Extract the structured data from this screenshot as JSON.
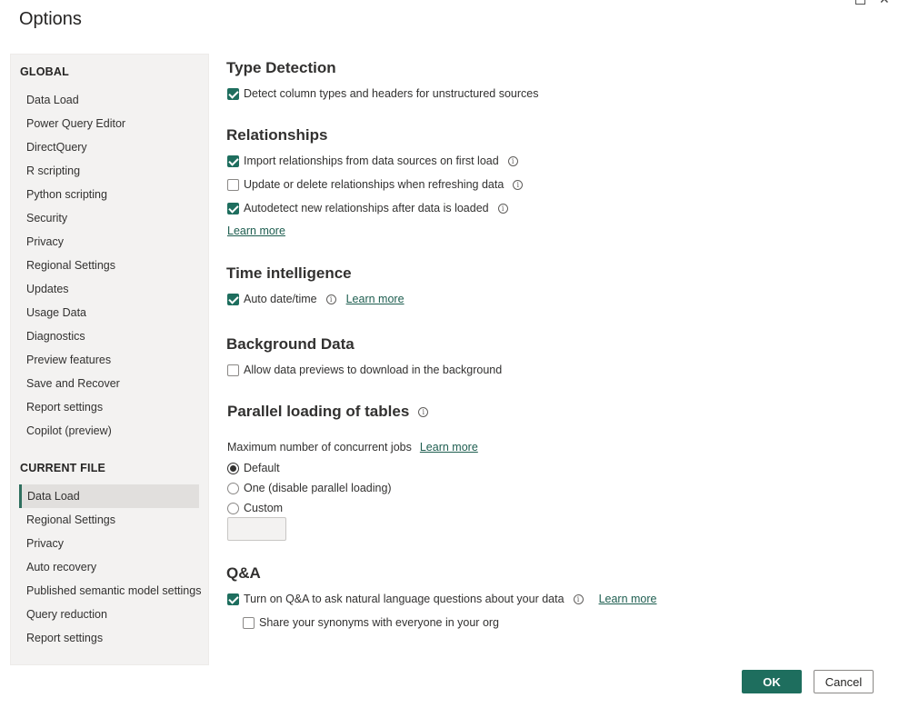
{
  "dialog": {
    "title": "Options"
  },
  "sidebar": {
    "global_header": "GLOBAL",
    "global_items": [
      "Data Load",
      "Power Query Editor",
      "DirectQuery",
      "R scripting",
      "Python scripting",
      "Security",
      "Privacy",
      "Regional Settings",
      "Updates",
      "Usage Data",
      "Diagnostics",
      "Preview features",
      "Save and Recover",
      "Report settings",
      "Copilot (preview)"
    ],
    "current_header": "CURRENT FILE",
    "current_items": [
      "Data Load",
      "Regional Settings",
      "Privacy",
      "Auto recovery",
      "Published semantic model settings",
      "Query reduction",
      "Report settings"
    ],
    "active_item": "Data Load"
  },
  "sections": {
    "type_detection": {
      "title": "Type Detection",
      "detect_label": "Detect column types and headers for unstructured sources",
      "detect_checked": true
    },
    "relationships": {
      "title": "Relationships",
      "import_label": "Import relationships from data sources on first load",
      "import_checked": true,
      "update_label": "Update or delete relationships when refreshing data",
      "update_checked": false,
      "autodetect_label": "Autodetect new relationships after data is loaded",
      "autodetect_checked": true,
      "learn_more": "Learn more"
    },
    "time_intelligence": {
      "title": "Time intelligence",
      "auto_label": "Auto date/time",
      "auto_checked": true,
      "learn_more": "Learn more"
    },
    "background_data": {
      "title": "Background Data",
      "allow_label": "Allow data previews to download in the background",
      "allow_checked": false
    },
    "parallel_loading": {
      "title": "Parallel loading of tables",
      "max_jobs_label": "Maximum number of concurrent jobs",
      "learn_more": "Learn more",
      "options": [
        "Default",
        "One (disable parallel loading)",
        "Custom"
      ],
      "selected": "Default",
      "custom_value": ""
    },
    "qna": {
      "title": "Q&A",
      "turn_on_label": "Turn on Q&A to ask natural language questions about your data",
      "turn_on_checked": true,
      "learn_more": "Learn more",
      "share_label": "Share your synonyms with everyone in your org",
      "share_checked": false
    }
  },
  "footer": {
    "ok_label": "OK",
    "cancel_label": "Cancel"
  },
  "colors": {
    "accent": "#1e6e5e",
    "sidebar_bg": "#f3f2f1",
    "active_bg": "#e1dfdd"
  }
}
